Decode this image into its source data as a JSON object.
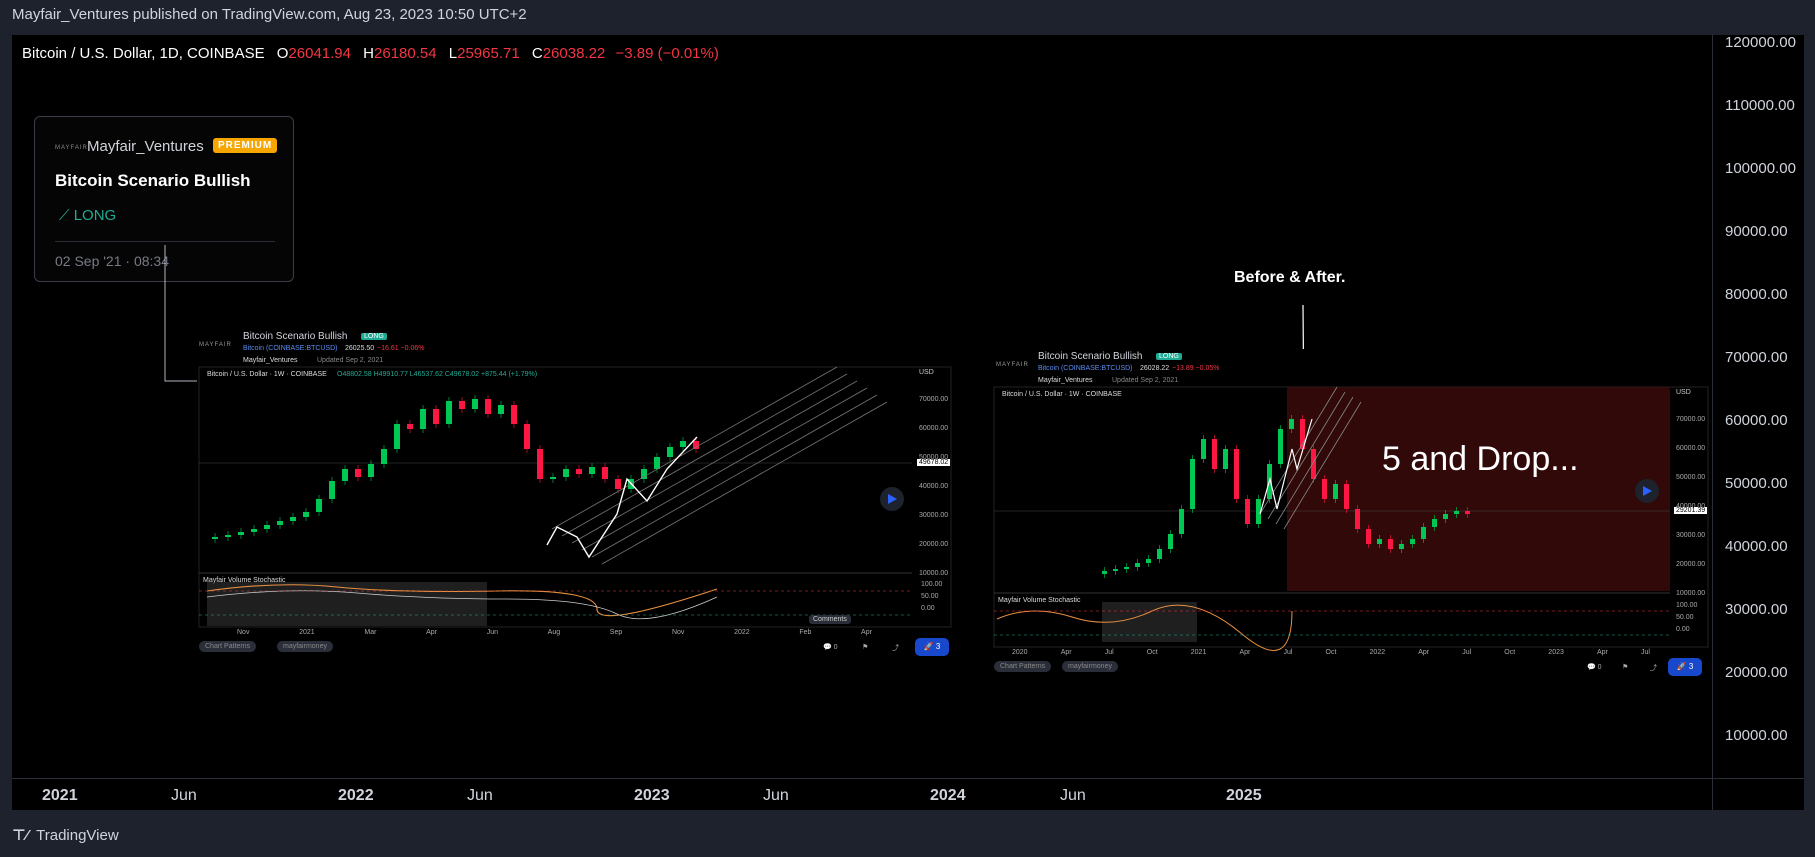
{
  "header": {
    "published": "Mayfair_Ventures published on TradingView.com, Aug 23, 2023 10:50 UTC+2"
  },
  "legend": {
    "symbol": "Bitcoin / U.S. Dollar, 1D, COINBASE",
    "o_label": "O",
    "o": "26041.94",
    "h_label": "H",
    "h": "26180.54",
    "l_label": "L",
    "l": "25965.71",
    "c_label": "C",
    "c": "26038.22",
    "change": "−3.89 (−0.01%)"
  },
  "idea_card": {
    "author": "Mayfair_Ventures",
    "badge": "PREMIUM",
    "title": "Bitcoin Scenario Bullish",
    "direction": "LONG",
    "date": "02 Sep '21 · 08:34"
  },
  "annotation": "Before & After.",
  "drop_text": "5 and Drop...",
  "footer": {
    "brand": "TradingView"
  },
  "colors": {
    "background": "#000000",
    "panel": "#1e222d",
    "up": "#22ab94",
    "down": "#f23645",
    "premium": "#f7a600",
    "bull_candle": "#00c853",
    "bear_candle": "#ff1744"
  },
  "mini_left": {
    "title": "Bitcoin Scenario Bullish",
    "badge": "LONG",
    "symbol": "Bitcoin (COINBASE:BTCUSD)",
    "price": "26025.50",
    "change": "−16.61 −0.06%",
    "author": "Mayfair_Ventures",
    "updated": "Updated Sep 2, 2021",
    "legend": "Bitcoin / U.S. Dollar · 1W · COINBASE",
    "ohlc": "O48802.58 H49910.77 L46537.62 C49678.02 +875.44 (+1.79%)",
    "indicator": "Mayfair Volume Stochastic",
    "tags": [
      "Chart Patterns",
      "mayfairmoney"
    ],
    "comments": "0",
    "boosts": "3",
    "currency": "USD",
    "price_tag": "49678.02",
    "axis": [
      "70000.00",
      "60000.00",
      "50000.00",
      "40000.00",
      "30000.00",
      "20000.00",
      "10000.00"
    ],
    "osc_axis": [
      "100.00",
      "50.00",
      "0.00"
    ],
    "dates": [
      "Nov",
      "2021",
      "Mar",
      "Apr",
      "Jun",
      "Aug",
      "Sep",
      "Nov",
      "2022",
      "Feb",
      "Apr"
    ],
    "tooltip": "Comments"
  },
  "mini_right": {
    "title": "Bitcoin Scenario Bullish",
    "badge": "LONG",
    "symbol": "Bitcoin (COINBASE:BTCUSD)",
    "price": "26028.22",
    "change": "−13.89 −0.05%",
    "author": "Mayfair_Ventures",
    "updated": "Updated Sep 2, 2021",
    "legend": "Bitcoin / U.S. Dollar · 1W · COINBASE",
    "indicator": "Mayfair Volume Stochastic",
    "tags": [
      "Chart Patterns",
      "mayfairmoney"
    ],
    "comments": "0",
    "boosts": "3",
    "currency": "USD",
    "price_tag": "29201.39",
    "axis": [
      "70000.00",
      "60000.00",
      "50000.00",
      "40000.00",
      "30000.00",
      "20000.00",
      "10000.00"
    ],
    "osc_axis": [
      "100.00",
      "50.00",
      "0.00"
    ],
    "dates": [
      "2020",
      "Apr",
      "Jul",
      "Oct",
      "2021",
      "Apr",
      "Jul",
      "Oct",
      "2022",
      "Apr",
      "Jul",
      "Oct",
      "2023",
      "Apr",
      "Jul"
    ]
  },
  "chart_data": {
    "type": "line",
    "title": "Bitcoin / U.S. Dollar, 1D, COINBASE",
    "xlabel": "",
    "ylabel": "",
    "ylim": [
      0,
      120000
    ],
    "yticks": [
      "120000.00",
      "110000.00",
      "100000.00",
      "90000.00",
      "80000.00",
      "70000.00",
      "60000.00",
      "50000.00",
      "40000.00",
      "30000.00",
      "20000.00",
      "10000.00"
    ],
    "xticks": [
      "2021",
      "Jun",
      "2022",
      "Jun",
      "2023",
      "Jun",
      "2024",
      "Jun",
      "2025"
    ],
    "grid": false,
    "legend": "top-left",
    "series": []
  }
}
